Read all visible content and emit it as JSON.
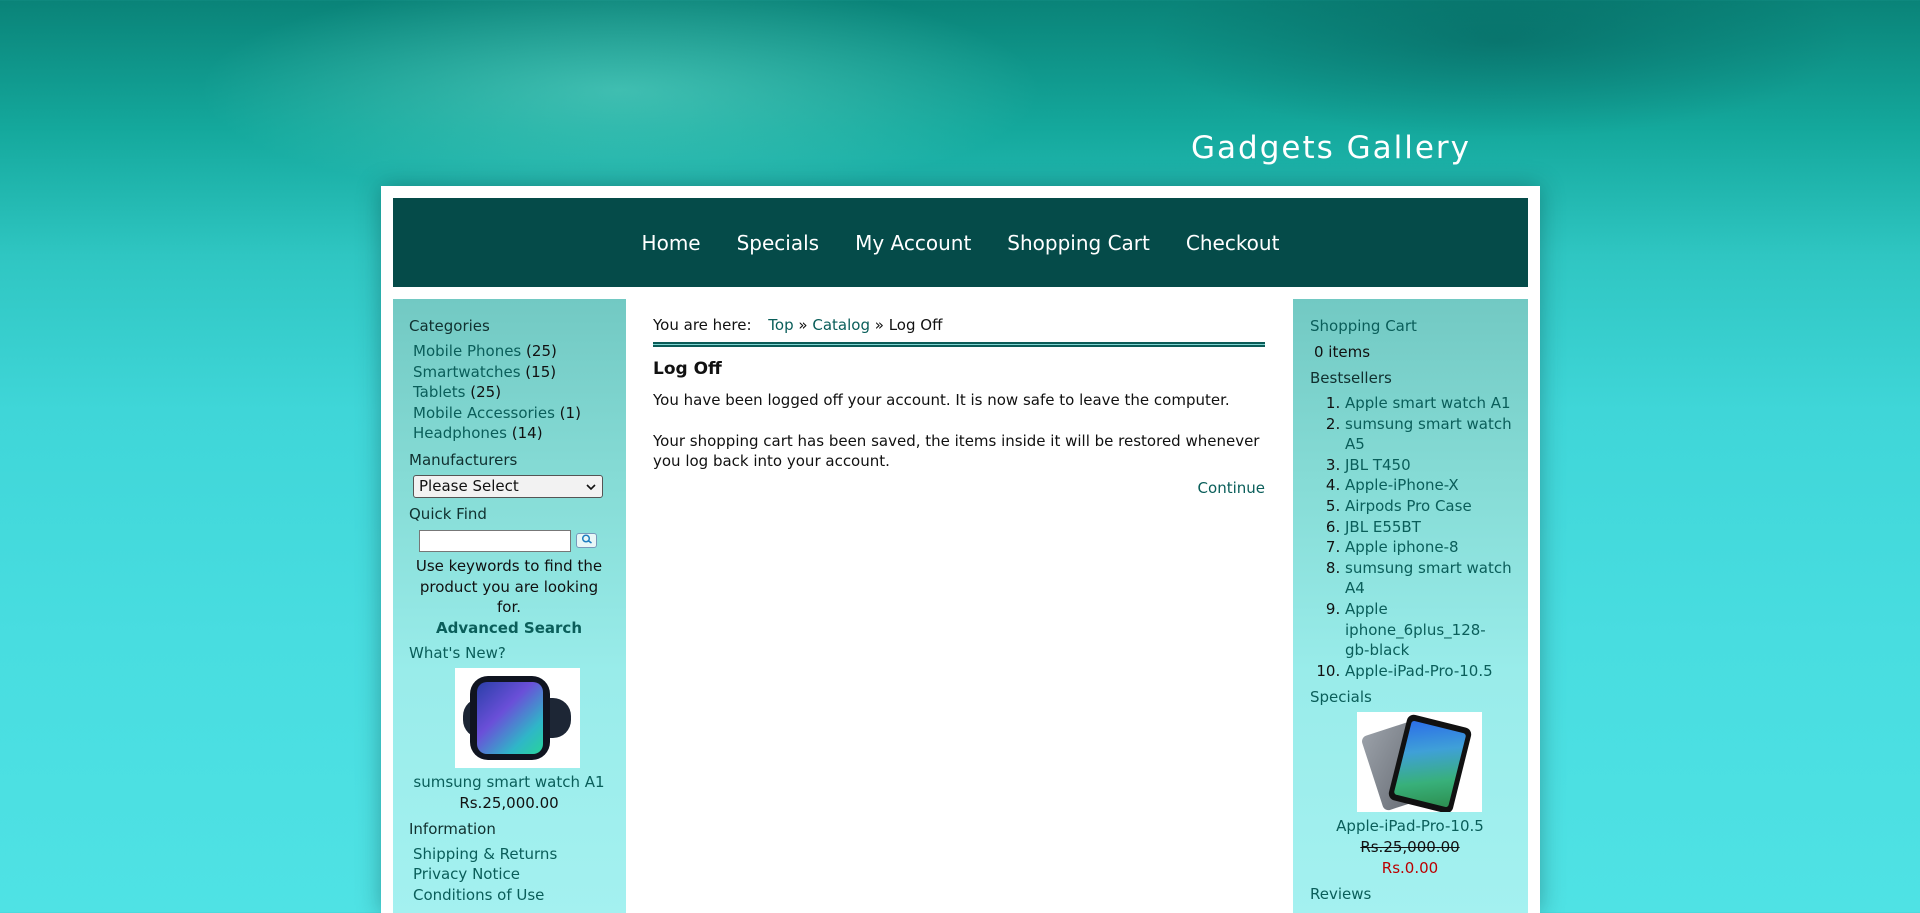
{
  "site": {
    "title": "Gadgets Gallery"
  },
  "nav": {
    "items": [
      {
        "label": "Home"
      },
      {
        "label": "Specials"
      },
      {
        "label": "My Account"
      },
      {
        "label": "Shopping Cart"
      },
      {
        "label": "Checkout"
      }
    ]
  },
  "left": {
    "categories_title": "Categories",
    "categories": [
      {
        "name": "Mobile Phones",
        "count": "(25)"
      },
      {
        "name": "Smartwatches",
        "count": "(15)"
      },
      {
        "name": "Tablets",
        "count": "(25)"
      },
      {
        "name": "Mobile Accessories",
        "count": "(1)"
      },
      {
        "name": "Headphones",
        "count": "(14)"
      }
    ],
    "manufacturers_title": "Manufacturers",
    "manufacturer_selected": "Please Select",
    "quick_find_title": "Quick Find",
    "quick_find_value": "",
    "quick_find_hint": "Use keywords to find the product you are looking for.",
    "advanced_search": "Advanced Search",
    "whats_new_title": "What's New?",
    "whats_new_product": {
      "name": "sumsung smart watch A1",
      "price": "Rs.25,000.00",
      "image_icon": "smartwatch-image"
    },
    "information_title": "Information",
    "information_links": [
      "Shipping & Returns",
      "Privacy Notice",
      "Conditions of Use"
    ]
  },
  "center": {
    "breadcrumb_lead": "You are here:",
    "breadcrumb": {
      "top": "Top",
      "catalog": "Catalog",
      "current": "Log Off",
      "sep": "»"
    },
    "heading": "Log Off",
    "para1": "You have been logged off your account. It is now safe to leave the computer.",
    "para2": "Your shopping cart has been saved, the items inside it will be restored whenever you log back into your account.",
    "continue": "Continue"
  },
  "right": {
    "cart_title": "Shopping Cart",
    "cart_items": "0 items",
    "bestsellers_title": "Bestsellers",
    "bestsellers": [
      "Apple smart watch A1",
      "sumsung smart watch A5",
      "JBL T450",
      "Apple-iPhone-X",
      "Airpods Pro Case",
      "JBL E55BT",
      "Apple iphone-8",
      "sumsung smart watch A4",
      "Apple iphone_6plus_128-gb-black",
      "Apple-iPad-Pro-10.5"
    ],
    "specials_title": "Specials",
    "special_product": {
      "name": "Apple-iPad-Pro-10.5",
      "old_price": "Rs.25,000.00",
      "new_price": "Rs.0.00",
      "image_icon": "tablet-image"
    },
    "reviews_title": "Reviews"
  },
  "colors": {
    "nav_bg": "#054b49",
    "link": "#0a5e5a",
    "special_price": "#bb0000"
  }
}
